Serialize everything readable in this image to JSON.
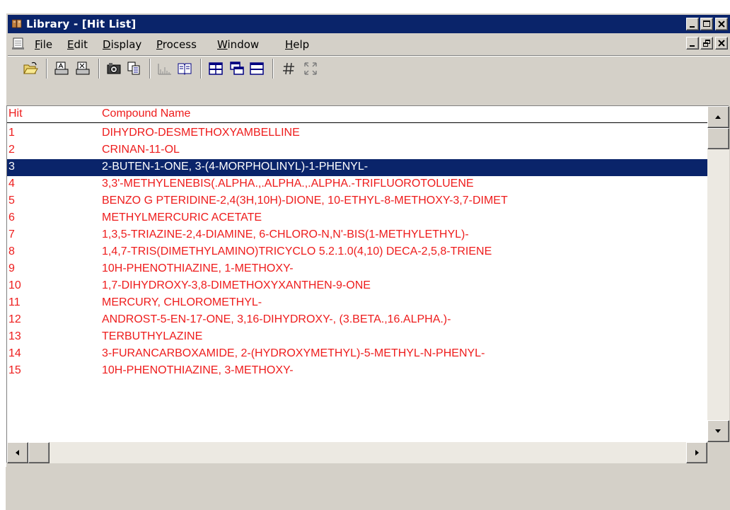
{
  "window": {
    "title": "Library - [Hit List]"
  },
  "menu": [
    {
      "label": "File",
      "key": "F",
      "rest": "ile"
    },
    {
      "label": "Edit",
      "key": "E",
      "rest": "dit"
    },
    {
      "label": "Display",
      "key": "D",
      "rest": "isplay"
    },
    {
      "label": "Process",
      "key": "P",
      "rest": "rocess"
    },
    {
      "label": "Window",
      "key": "W",
      "rest": "indow"
    },
    {
      "label": "Help",
      "key": "H",
      "rest": "elp"
    }
  ],
  "toolbar": {
    "icons": [
      "open-folder-icon",
      "print-icon",
      "print-preview-icon",
      "camera-icon",
      "copy-icon",
      "spectrum-icon",
      "book-icon",
      "tile-icon",
      "cascade-icon",
      "arrange-icon",
      "number-icon",
      "fullscreen-icon"
    ]
  },
  "list": {
    "columns": {
      "hit": "Hit",
      "name": "Compound Name"
    },
    "selected_hit": "3",
    "rows": [
      {
        "hit": "1",
        "name": "DIHYDRO-DESMETHOXYAMBELLINE"
      },
      {
        "hit": "2",
        "name": "CRINAN-11-OL"
      },
      {
        "hit": "3",
        "name": "2-BUTEN-1-ONE, 3-(4-MORPHOLINYL)-1-PHENYL-"
      },
      {
        "hit": "4",
        "name": "3,3'-METHYLENEBIS(.ALPHA.,.ALPHA.,.ALPHA.-TRIFLUOROTOLUENE"
      },
      {
        "hit": "5",
        "name": "BENZO G PTERIDINE-2,4(3H,10H)-DIONE, 10-ETHYL-8-METHOXY-3,7-DIMET"
      },
      {
        "hit": "6",
        "name": "METHYLMERCURIC ACETATE"
      },
      {
        "hit": "7",
        "name": "1,3,5-TRIAZINE-2,4-DIAMINE, 6-CHLORO-N,N'-BIS(1-METHYLETHYL)-"
      },
      {
        "hit": "8",
        "name": "1,4,7-TRIS(DIMETHYLAMINO)TRICYCLO 5.2.1.0(4,10) DECA-2,5,8-TRIENE"
      },
      {
        "hit": "9",
        "name": "10H-PHENOTHIAZINE, 1-METHOXY-"
      },
      {
        "hit": "10",
        "name": "1,7-DIHYDROXY-3,8-DIMETHOXYXANTHEN-9-ONE"
      },
      {
        "hit": "11",
        "name": "MERCURY, CHLOROMETHYL-"
      },
      {
        "hit": "12",
        "name": "ANDROST-5-EN-17-ONE, 3,16-DIHYDROXY-, (3.BETA.,16.ALPHA.)-"
      },
      {
        "hit": "13",
        "name": "TERBUTHYLAZINE"
      },
      {
        "hit": "14",
        "name": "3-FURANCARBOXAMIDE, 2-(HYDROXYMETHYL)-5-METHYL-N-PHENYL-"
      },
      {
        "hit": "15",
        "name": "10H-PHENOTHIAZINE, 3-METHOXY-"
      }
    ]
  },
  "colors": {
    "text": "#ee1c1c",
    "selection": "#0a246a",
    "titlebar": "#0a246a",
    "chrome": "#d4d0c8"
  }
}
